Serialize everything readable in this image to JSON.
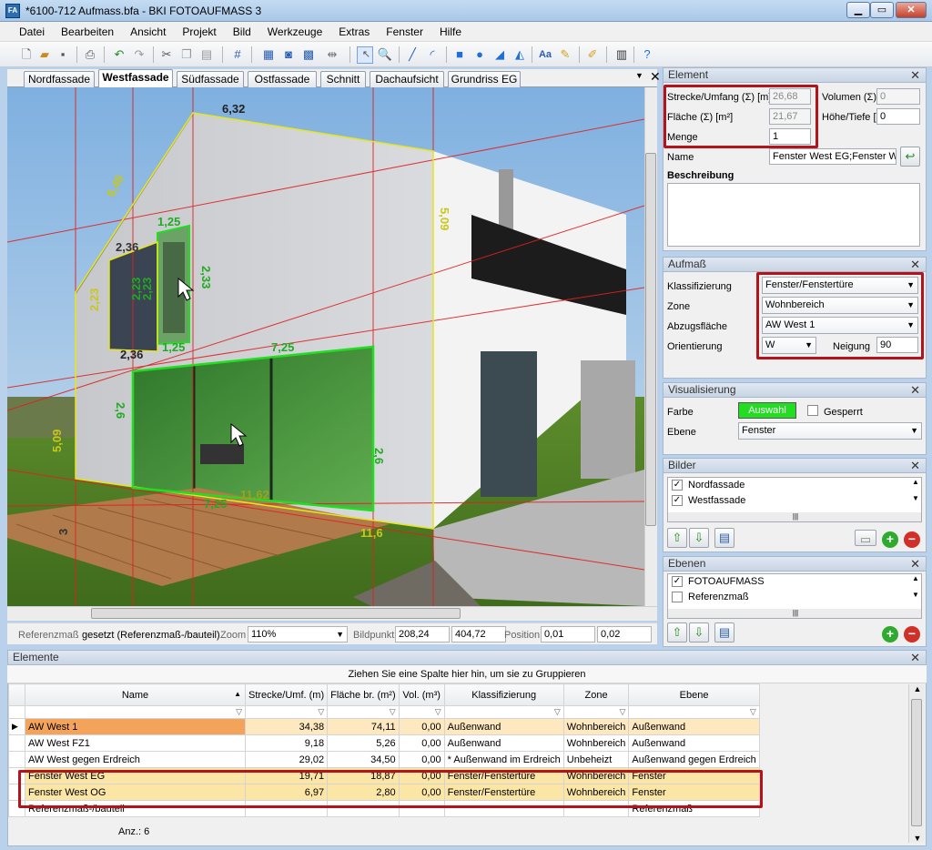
{
  "window": {
    "title": "*6100-712 Aufmass.bfa - BKI FOTOAUFMASS 3",
    "icon": "FA"
  },
  "menu": [
    "Datei",
    "Bearbeiten",
    "Ansicht",
    "Projekt",
    "Bild",
    "Werkzeuge",
    "Extras",
    "Fenster",
    "Hilfe"
  ],
  "tabs": [
    "Nordfassade",
    "Westfassade",
    "Südfassade",
    "Ostfassade",
    "Schnitt",
    "Dachaufsicht",
    "Grundriss EG"
  ],
  "active_tab": "Westfassade",
  "measurements": {
    "gable_top": "6,32",
    "gable_left": "6,46",
    "right_height": "5,09",
    "win_w1": "2,36",
    "win_w2": "1,25",
    "win_h1": "2,23",
    "win_h2": "2,23",
    "win_bottom1": "2,36",
    "win_bottom2": "1,25",
    "win_top2": "1,25",
    "big_w": "7,25",
    "big_h_left": "2,6",
    "big_h_right": "2,6",
    "big_bottom": "7,25",
    "wall_bottom": "11,62",
    "left_h": "5,09",
    "corner_h": "11,6",
    "small_left": "2,33",
    "small_right": "3",
    "win_side": "2,23",
    "base_left": "3"
  },
  "status": {
    "ref_label": "Referenzmaß",
    "ref_value": "gesetzt (Referenzmaß-/bauteil)",
    "zoom_label": "Zoom",
    "zoom_value": "110%",
    "bildpunkt_label": "Bildpunkt",
    "bp_x": "208,24",
    "bp_y": "404,72",
    "position_label": "Position",
    "pos_x": "0,01",
    "pos_y": "0,02"
  },
  "element_panel": {
    "title": "Element",
    "strecke_label": "Strecke/Umfang (Σ) [m]",
    "strecke_value": "26,68",
    "flaeche_label": "Fläche (Σ) [m²]",
    "flaeche_value": "21,67",
    "menge_label": "Menge",
    "menge_value": "1",
    "volumen_label": "Volumen (Σ)",
    "volumen_value": "0",
    "hoehe_label": "Höhe/Tiefe [",
    "hoehe_value": "0",
    "name_label": "Name",
    "name_value": "Fenster West EG;Fenster We",
    "beschreibung_label": "Beschreibung"
  },
  "aufmass_panel": {
    "title": "Aufmaß",
    "klass_label": "Klassifizierung",
    "klass_value": "Fenster/Fenstertüre",
    "zone_label": "Zone",
    "zone_value": "Wohnbereich",
    "abzug_label": "Abzugsfläche",
    "abzug_value": "AW West 1",
    "orient_label": "Orientierung",
    "orient_value": "W",
    "neigung_label": "Neigung",
    "neigung_value": "90"
  },
  "visual_panel": {
    "title": "Visualisierung",
    "farbe_label": "Farbe",
    "farbe_button": "Auswahl",
    "farbe_color": "#22dd22",
    "gesperrt_label": "Gesperrt",
    "ebene_label": "Ebene",
    "ebene_value": "Fenster"
  },
  "bilder_panel": {
    "title": "Bilder",
    "items": [
      "Nordfassade",
      "Westfassade"
    ]
  },
  "ebenen_panel": {
    "title": "Ebenen",
    "items": [
      {
        "label": "FOTOAUFMASS",
        "checked": true
      },
      {
        "label": "Referenzmaß",
        "checked": false
      }
    ]
  },
  "elements_panel": {
    "title": "Elemente",
    "group_hint": "Ziehen Sie eine Spalte hier hin, um sie zu Gruppieren",
    "columns": [
      "Name",
      "Strecke/Umf. (m)",
      "Fläche br. (m²)",
      "Vol. (m³)",
      "Klassifizierung",
      "Zone",
      "Ebene"
    ],
    "rows": [
      [
        "AW West 1",
        "34,38",
        "74,11",
        "0,00",
        "Außenwand",
        "Wohnbereich",
        "Außenwand"
      ],
      [
        "AW West FZ1",
        "9,18",
        "5,26",
        "0,00",
        "Außenwand",
        "Wohnbereich",
        "Außenwand"
      ],
      [
        "AW West gegen Erdreich",
        "29,02",
        "34,50",
        "0,00",
        "* Außenwand im Erdreich",
        "Unbeheizt",
        "Außenwand gegen Erdreich"
      ],
      [
        "Fenster West EG",
        "19,71",
        "18,87",
        "0,00",
        "Fenster/Fenstertüre",
        "Wohnbereich",
        "Fenster"
      ],
      [
        "Fenster West OG",
        "6,97",
        "2,80",
        "0,00",
        "Fenster/Fenstertüre",
        "Wohnbereich",
        "Fenster"
      ],
      [
        "Referenzmaß-/bauteil",
        "",
        "",
        "",
        "",
        "",
        "Referenzmaß"
      ]
    ],
    "count_label": "Anz.: 6"
  }
}
